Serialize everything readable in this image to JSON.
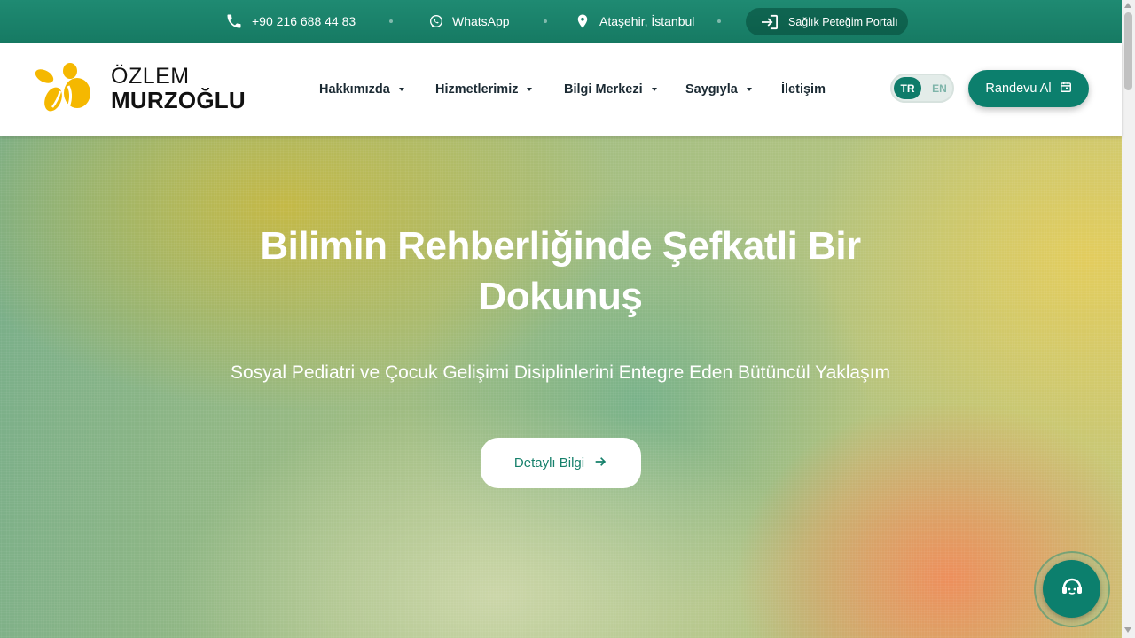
{
  "topbar": {
    "phone": "+90 216 688 44 83",
    "whatsapp": "WhatsApp",
    "location": "Ataşehir, İstanbul",
    "portal": "Sağlık Peteğim Portalı"
  },
  "brand": {
    "line1": "ÖZLEM",
    "line2": "MURZOĞLU"
  },
  "nav": {
    "items": [
      {
        "label": "Hakkımızda"
      },
      {
        "label": "Hizmetlerimiz"
      },
      {
        "label": "Bilgi Merkezi"
      },
      {
        "label": "Saygıyla"
      },
      {
        "label": "İletişim"
      }
    ]
  },
  "lang": {
    "active": "TR",
    "other": "EN"
  },
  "cta": {
    "label": "Randevu Al"
  },
  "hero": {
    "title": "Bilimin Rehberliğinde Şefkatli Bir Dokunuş",
    "subtitle": "Sosyal Pediatri ve Çocuk Gelişimi Disiplinlerini Entegre Eden Bütüncül Yaklaşım",
    "button": "Detaylı Bilgi"
  },
  "colors": {
    "primary": "#0c7f6d",
    "topbar": "#1f8a72",
    "logo_yellow": "#f5b800"
  }
}
